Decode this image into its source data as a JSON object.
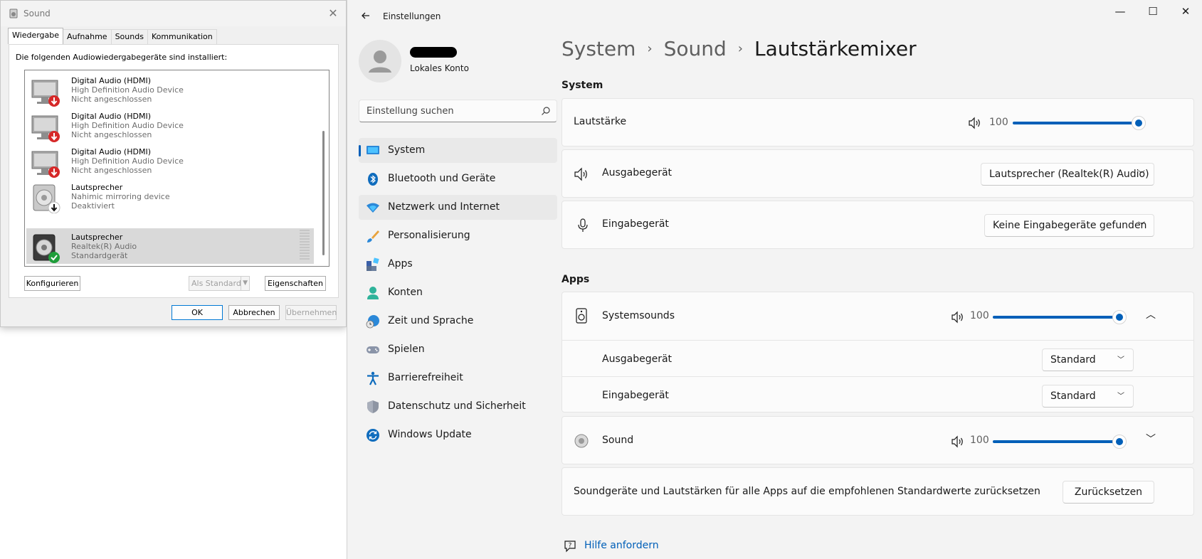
{
  "sound_dialog": {
    "title": "Sound",
    "tabs": [
      "Wiedergabe",
      "Aufnahme",
      "Sounds",
      "Kommunikation"
    ],
    "info_text": "Die folgenden Audiowiedergabegeräte sind installiert:",
    "devices": [
      {
        "name": "Digital Audio (HDMI)",
        "driver": "High Definition Audio Device",
        "status": "Nicht angeschlossen",
        "icon": "monitor-icon",
        "badge": "red-down-arrow"
      },
      {
        "name": "Digital Audio (HDMI)",
        "driver": "High Definition Audio Device",
        "status": "Nicht angeschlossen",
        "icon": "monitor-icon",
        "badge": "red-down-arrow"
      },
      {
        "name": "Digital Audio (HDMI)",
        "driver": "High Definition Audio Device",
        "status": "Nicht angeschlossen",
        "icon": "monitor-icon",
        "badge": "red-down-arrow"
      },
      {
        "name": "Lautsprecher",
        "driver": "Nahimic mirroring device",
        "status": "Deaktiviert",
        "icon": "speaker-icon",
        "badge": "black-down-arrow"
      },
      {
        "name": "Lautsprecher",
        "driver": "Realtek(R) Audio",
        "status": "Standardgerät",
        "icon": "speaker-icon",
        "badge": "green-check",
        "selected": true
      }
    ],
    "buttons": {
      "configure": "Konfigurieren",
      "set_default": "Als Standard",
      "properties": "Eigenschaften",
      "ok": "OK",
      "cancel": "Abbrechen",
      "apply": "Übernehmen"
    }
  },
  "settings": {
    "window_title": "Einstellungen",
    "window_controls": {
      "minimize": "—",
      "maximize": "☐",
      "close": "✕"
    },
    "profile": {
      "subtitle": "Lokales Konto"
    },
    "search": {
      "placeholder": "Einstellung suchen"
    },
    "nav": [
      {
        "label": "System",
        "icon": "system-icon",
        "active": true
      },
      {
        "label": "Bluetooth und Geräte",
        "icon": "bluetooth-icon"
      },
      {
        "label": "Netzwerk und Internet",
        "icon": "wifi-icon"
      },
      {
        "label": "Personalisierung",
        "icon": "brush-icon"
      },
      {
        "label": "Apps",
        "icon": "apps-icon"
      },
      {
        "label": "Konten",
        "icon": "account-icon"
      },
      {
        "label": "Zeit und Sprache",
        "icon": "time-language-icon"
      },
      {
        "label": "Spielen",
        "icon": "gamepad-icon"
      },
      {
        "label": "Barrierefreiheit",
        "icon": "accessibility-icon"
      },
      {
        "label": "Datenschutz und Sicherheit",
        "icon": "shield-icon"
      },
      {
        "label": "Windows Update",
        "icon": "update-icon"
      }
    ],
    "breadcrumb": {
      "part1": "System",
      "part2": "Sound",
      "current": "Lautstärkemixer",
      "separator": "›"
    },
    "system_section": {
      "title": "System",
      "volume_label": "Lautstärke",
      "volume_value": "100",
      "volume_level": 1.0,
      "output_label": "Ausgabegerät",
      "output_value": "Lautsprecher (Realtek(R) Audio)",
      "input_label": "Eingabegerät",
      "input_value": "Keine Eingabegeräte gefunden"
    },
    "apps_section": {
      "title": "Apps",
      "systemsounds": {
        "label": "Systemsounds",
        "volume_value": "100",
        "volume_level": 1.0,
        "output_label": "Ausgabegerät",
        "output_value": "Standard",
        "input_label": "Eingabegerät",
        "input_value": "Standard"
      },
      "sound_app": {
        "label": "Sound",
        "volume_value": "100",
        "volume_level": 1.0
      }
    },
    "reset": {
      "text": "Soundgeräte und Lautstärken für alle Apps auf die empfohlenen Standardwerte zurücksetzen",
      "button": "Zurücksetzen"
    },
    "help": {
      "label": "Hilfe anfordern"
    },
    "colors": {
      "accent": "#005fb8",
      "background": "#f3f3f3",
      "card": "#fbfbfb"
    }
  }
}
